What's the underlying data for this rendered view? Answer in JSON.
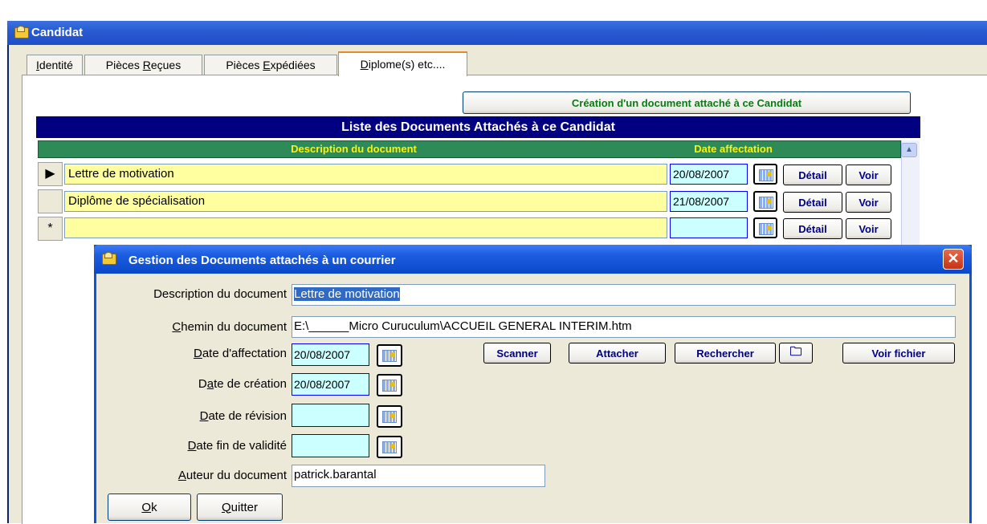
{
  "window": {
    "title": "Candidat",
    "tabs": [
      {
        "key": "I",
        "rest": "dentité",
        "active": false
      },
      {
        "pre": "Pièces ",
        "key": "R",
        "rest": "eçues",
        "active": false
      },
      {
        "pre": "Pièces ",
        "key": "E",
        "rest": "xpédiées",
        "active": false
      },
      {
        "key": "D",
        "rest": "iplome(s) etc....",
        "active": true
      }
    ]
  },
  "create_button": "Création d'un document attaché à ce Candidat",
  "list": {
    "title": "Liste  des Documents Attachés à ce Candidat",
    "col_description": "Description du document",
    "col_date": "Date affectation",
    "rows": [
      {
        "marker": "▶",
        "description": "Lettre de motivation",
        "date": "20/08/2007"
      },
      {
        "marker": "",
        "description": "Diplôme de spécialisation",
        "date": "21/08/2007"
      },
      {
        "marker": "*",
        "description": "",
        "date": ""
      }
    ],
    "detail_label": "Détail",
    "voir_label": "Voir"
  },
  "dialog": {
    "title": "Gestion des Documents attachés à un courrier",
    "close": "✕",
    "description_label": "Description du document",
    "description_value": "Lettre de motivation",
    "chemin_label_key": "C",
    "chemin_label_rest": "hemin du document",
    "chemin_value": "E:\\______Micro Curuculum\\ACCUEIL GENERAL INTERIM.htm",
    "affectation_label_key": "D",
    "affectation_label_rest": "ate d'affectation",
    "affectation_value": "20/08/2007",
    "creation_label_pre": "D",
    "creation_label_key": "a",
    "creation_label_rest": "te de création",
    "creation_value": "20/08/2007",
    "revision_label_key": "D",
    "revision_label_rest": "ate de révision",
    "revision_value": "",
    "fin_label_key": "D",
    "fin_label_rest": "ate fin de validité",
    "fin_value": "",
    "auteur_label_key": "A",
    "auteur_label_rest": "uteur du document",
    "auteur_value": "patrick.barantal",
    "buttons": {
      "scanner": "Scanner",
      "attacher": "Attacher",
      "rechercher": "Rechercher",
      "voir_fichier": "Voir fichier",
      "ok_key": "O",
      "ok_rest": "k",
      "quitter_key": "Q",
      "quitter_rest": "uitter"
    }
  },
  "icons": {
    "window_icon": "folder-icon",
    "calendar": "calendar-icon",
    "open_folder": "open-folder-icon"
  }
}
